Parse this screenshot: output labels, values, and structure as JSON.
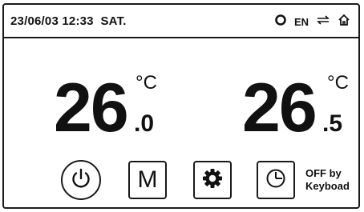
{
  "status_bar": {
    "datetime": "23/06/03 12:33  SAT.",
    "language": "EN",
    "icons": [
      "sync-icon",
      "transfer-icon",
      "home-icon"
    ]
  },
  "temperatures": {
    "left": {
      "integer": "26",
      "unit": "°C",
      "decimal": ".0"
    },
    "right": {
      "integer": "26",
      "unit": "°C",
      "decimal": ".5"
    }
  },
  "controls": {
    "power_icon": "power-icon",
    "mode_label": "M",
    "settings_icon": "gear-icon",
    "timer_icon": "clock-icon"
  },
  "status_note": {
    "line1": "OFF by",
    "line2": "Keyboad"
  }
}
